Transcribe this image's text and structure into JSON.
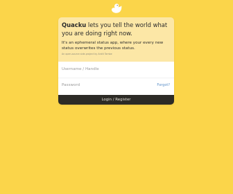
{
  "brand": {
    "logo_icon": "duck-icon",
    "logo_color": "#ffffff"
  },
  "intro": {
    "brand_name": "Quacku",
    "headline_rest": " lets you tell the world what you are doing right now.",
    "description": "It's an ephemeral status app, where your every new status overwrites the previous status.",
    "fineprint": "An open-source side-project by Ankit Tambe"
  },
  "login": {
    "username_placeholder": "Username / Handle",
    "password_placeholder": "Password",
    "forgot_label": "Forgot?",
    "submit_label": "Login / Register"
  },
  "colors": {
    "background": "#fbd54a",
    "intro_bg": "#fce7a6",
    "button_bg": "#2d2b26",
    "link": "#5b8fc8"
  }
}
